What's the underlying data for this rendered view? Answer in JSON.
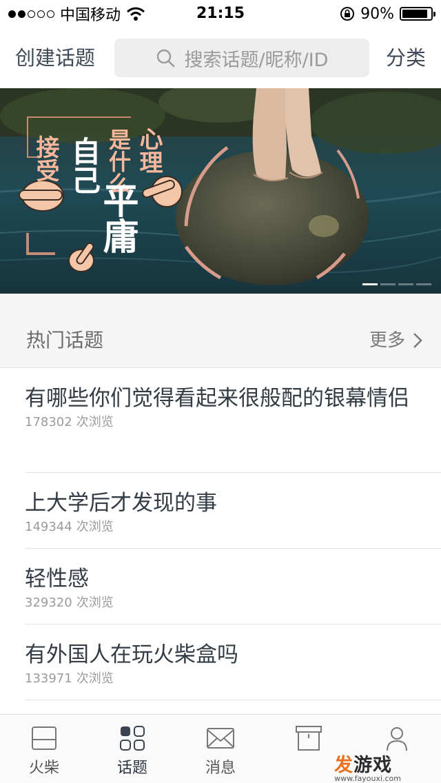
{
  "status_bar": {
    "carrier": "中国移动",
    "time": "21:15",
    "battery_percent": "90%",
    "battery_level": 0.9
  },
  "top_nav": {
    "create_label": "创建话题",
    "search_placeholder": "搜索话题/昵称/ID",
    "category_label": "分类"
  },
  "banner": {
    "text_col1": "接受",
    "text_col2": "自己",
    "text_col3": "是什么",
    "text_col4": "心理",
    "text_big": "平庸",
    "slide_count": 4,
    "active_slide": 0
  },
  "hot_section": {
    "title": "热门话题",
    "more_label": "更多"
  },
  "topics": [
    {
      "title": "有哪些你们觉得看起来很般配的银幕情侣",
      "views": "178302",
      "views_suffix": "次浏览"
    },
    {
      "title": "上大学后才发现的事",
      "views": "149344",
      "views_suffix": "次浏览"
    },
    {
      "title": "轻性感",
      "views": "329320",
      "views_suffix": "次浏览"
    },
    {
      "title": "有外国人在玩火柴盒吗",
      "views": "133971",
      "views_suffix": "次浏览"
    }
  ],
  "tabs": [
    {
      "label": "火柴",
      "icon": "matchbox-icon"
    },
    {
      "label": "话题",
      "icon": "grid-icon"
    },
    {
      "label": "消息",
      "icon": "envelope-icon"
    },
    {
      "label": "",
      "icon": "box-icon"
    },
    {
      "label": "",
      "icon": "person-icon"
    }
  ],
  "watermark": {
    "main_a": "发",
    "main_b": "游戏",
    "url": "www.fayouxi.com"
  }
}
